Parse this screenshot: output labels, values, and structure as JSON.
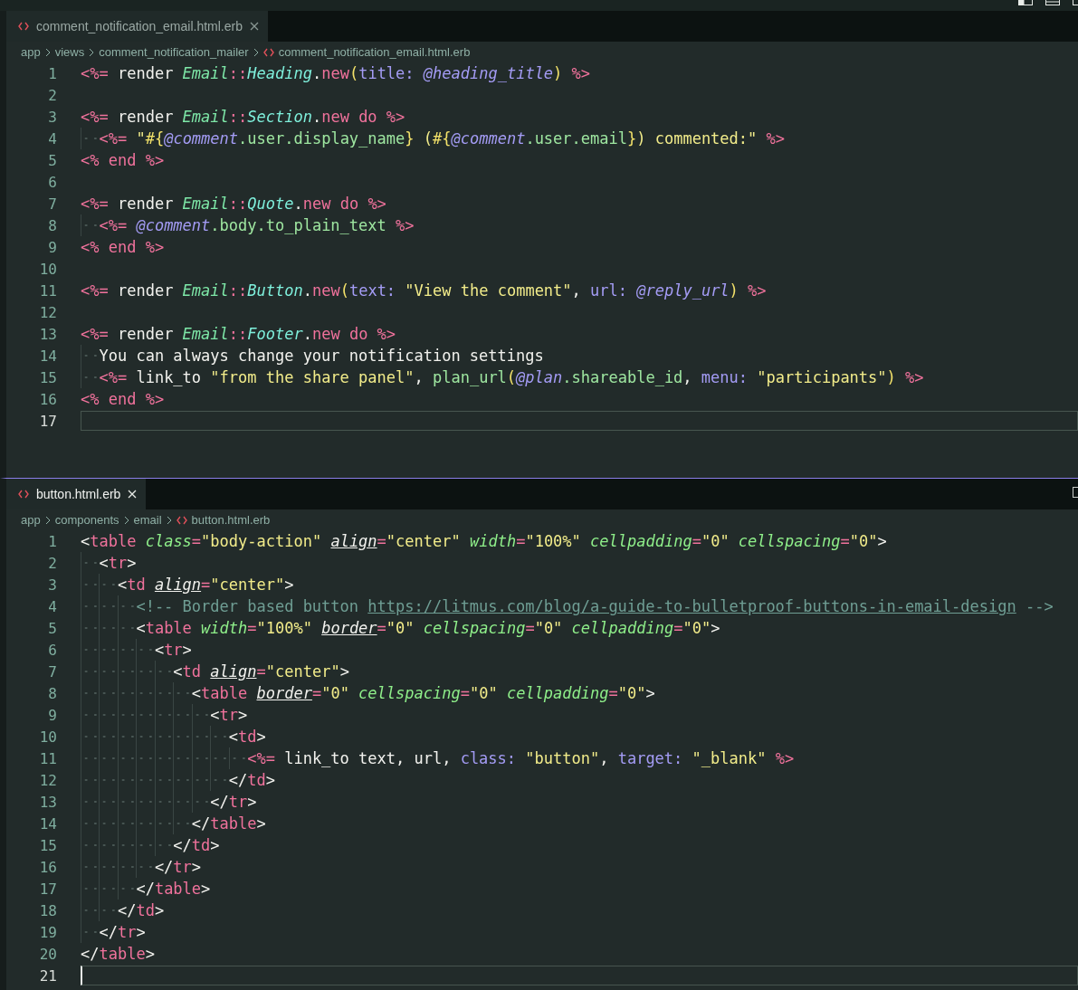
{
  "editors": [
    {
      "tab": {
        "label": "comment_notification_email.html.erb",
        "selected": false
      },
      "breadcrumbs": [
        {
          "label": "app",
          "kind": "folder"
        },
        {
          "label": "views",
          "kind": "folder"
        },
        {
          "label": "comment_notification_mailer",
          "kind": "folder"
        },
        {
          "label": "comment_notification_email.html.erb",
          "kind": "file"
        }
      ],
      "lines": [
        {
          "number": "1",
          "tokens": [
            {
              "text": "<%=",
              "kind": "delim"
            },
            {
              "text": " render ",
              "kind": "text"
            },
            {
              "text": "Email",
              "kind": "constant"
            },
            {
              "text": "::",
              "kind": "keyword"
            },
            {
              "text": "Heading",
              "kind": "class"
            },
            {
              "text": ".",
              "kind": "text"
            },
            {
              "text": "new",
              "kind": "keyword"
            },
            {
              "text": "(",
              "kind": "paren"
            },
            {
              "text": "title:",
              "kind": "symbol"
            },
            {
              "text": " @heading_title",
              "kind": "ivar"
            },
            {
              "text": ")",
              "kind": "paren"
            },
            {
              "text": " %>",
              "kind": "delim"
            }
          ]
        },
        {
          "number": "2"
        },
        {
          "number": "3",
          "tokens": [
            {
              "text": "<%=",
              "kind": "delim"
            },
            {
              "text": " render ",
              "kind": "text"
            },
            {
              "text": "Email",
              "kind": "constant"
            },
            {
              "text": "::",
              "kind": "keyword"
            },
            {
              "text": "Section",
              "kind": "class"
            },
            {
              "text": ".",
              "kind": "text"
            },
            {
              "text": "new do",
              "kind": "keyword"
            },
            {
              "text": " %>",
              "kind": "delim"
            }
          ],
          "children": [
            {
              "number": "4",
              "tokens": [
                {
                  "text": "<%=",
                  "kind": "delim"
                },
                {
                  "text": " \"",
                  "kind": "string"
                },
                {
                  "text": "#{",
                  "kind": "paren"
                },
                {
                  "text": "@comment",
                  "kind": "ivar"
                },
                {
                  "text": ".user.display_name",
                  "kind": "method"
                },
                {
                  "text": "}",
                  "kind": "paren"
                },
                {
                  "text": " (",
                  "kind": "string"
                },
                {
                  "text": "#{",
                  "kind": "paren"
                },
                {
                  "text": "@comment",
                  "kind": "ivar"
                },
                {
                  "text": ".user.email",
                  "kind": "method"
                },
                {
                  "text": "}",
                  "kind": "paren"
                },
                {
                  "text": ") commented:\"",
                  "kind": "string"
                },
                {
                  "text": " %>",
                  "kind": "delim"
                }
              ]
            }
          ]
        },
        {
          "number": "5",
          "tokens": [
            {
              "text": "<%",
              "kind": "delim"
            },
            {
              "text": " end ",
              "kind": "keyword"
            },
            {
              "text": "%>",
              "kind": "delim"
            }
          ]
        },
        {
          "number": "6"
        },
        {
          "number": "7",
          "tokens": [
            {
              "text": "<%=",
              "kind": "delim"
            },
            {
              "text": " render ",
              "kind": "text"
            },
            {
              "text": "Email",
              "kind": "constant"
            },
            {
              "text": "::",
              "kind": "keyword"
            },
            {
              "text": "Quote",
              "kind": "class"
            },
            {
              "text": ".",
              "kind": "text"
            },
            {
              "text": "new do",
              "kind": "keyword"
            },
            {
              "text": " %>",
              "kind": "delim"
            }
          ],
          "children": [
            {
              "number": "8",
              "tokens": [
                {
                  "text": "<%=",
                  "kind": "delim"
                },
                {
                  "text": " @comment",
                  "kind": "ivar"
                },
                {
                  "text": ".body.to_plain_text",
                  "kind": "method"
                },
                {
                  "text": " %>",
                  "kind": "delim"
                }
              ]
            }
          ]
        },
        {
          "number": "9",
          "tokens": [
            {
              "text": "<%",
              "kind": "delim"
            },
            {
              "text": " end ",
              "kind": "keyword"
            },
            {
              "text": "%>",
              "kind": "delim"
            }
          ]
        },
        {
          "number": "10"
        },
        {
          "number": "11",
          "tokens": [
            {
              "text": "<%=",
              "kind": "delim"
            },
            {
              "text": " render ",
              "kind": "text"
            },
            {
              "text": "Email",
              "kind": "constant"
            },
            {
              "text": "::",
              "kind": "keyword"
            },
            {
              "text": "Button",
              "kind": "class"
            },
            {
              "text": ".",
              "kind": "text"
            },
            {
              "text": "new",
              "kind": "keyword"
            },
            {
              "text": "(",
              "kind": "paren"
            },
            {
              "text": "text:",
              "kind": "symbol"
            },
            {
              "text": " \"View the comment\"",
              "kind": "string"
            },
            {
              "text": ", ",
              "kind": "text"
            },
            {
              "text": "url:",
              "kind": "symbol"
            },
            {
              "text": " @reply_url",
              "kind": "ivar"
            },
            {
              "text": ")",
              "kind": "paren"
            },
            {
              "text": " %>",
              "kind": "delim"
            }
          ]
        },
        {
          "number": "12"
        },
        {
          "number": "13",
          "tokens": [
            {
              "text": "<%=",
              "kind": "delim"
            },
            {
              "text": " render ",
              "kind": "text"
            },
            {
              "text": "Email",
              "kind": "constant"
            },
            {
              "text": "::",
              "kind": "keyword"
            },
            {
              "text": "Footer",
              "kind": "class"
            },
            {
              "text": ".",
              "kind": "text"
            },
            {
              "text": "new do",
              "kind": "keyword"
            },
            {
              "text": " %>",
              "kind": "delim"
            }
          ],
          "children": [
            {
              "number": "14",
              "tokens": [
                {
                  "text": "You can always change your notification settings",
                  "kind": "text"
                }
              ]
            },
            {
              "number": "15",
              "tokens": [
                {
                  "text": "<%=",
                  "kind": "delim"
                },
                {
                  "text": " link_to ",
                  "kind": "text"
                },
                {
                  "text": "\"from the share panel\"",
                  "kind": "string"
                },
                {
                  "text": ", ",
                  "kind": "text"
                },
                {
                  "text": "plan_url",
                  "kind": "method"
                },
                {
                  "text": "(",
                  "kind": "paren"
                },
                {
                  "text": "@plan",
                  "kind": "ivar"
                },
                {
                  "text": ".shareable_id",
                  "kind": "method"
                },
                {
                  "text": ", ",
                  "kind": "text"
                },
                {
                  "text": "menu:",
                  "kind": "symbol"
                },
                {
                  "text": " \"participants\"",
                  "kind": "string"
                },
                {
                  "text": ")",
                  "kind": "paren"
                },
                {
                  "text": " %>",
                  "kind": "delim"
                }
              ]
            }
          ]
        },
        {
          "number": "16",
          "tokens": [
            {
              "text": "<%",
              "kind": "delim"
            },
            {
              "text": " end ",
              "kind": "keyword"
            },
            {
              "text": "%>",
              "kind": "delim"
            }
          ]
        },
        {
          "number": "17",
          "current": true
        }
      ]
    },
    {
      "tab": {
        "label": "button.html.erb",
        "selected": true
      },
      "breadcrumbs": [
        {
          "label": "app",
          "kind": "folder"
        },
        {
          "label": "components",
          "kind": "folder"
        },
        {
          "label": "email",
          "kind": "folder"
        },
        {
          "label": "button.html.erb",
          "kind": "file"
        }
      ],
      "lines": [
        {
          "number": "1",
          "tokens": [
            {
              "text": "<",
              "kind": "text"
            },
            {
              "text": "table ",
              "kind": "tag"
            },
            {
              "text": "class",
              "kind": "attr"
            },
            {
              "text": "=",
              "kind": "keyword"
            },
            {
              "text": "\"body-action\" ",
              "kind": "string"
            },
            {
              "text": "align",
              "kind": "attr-deprecated"
            },
            {
              "text": "=",
              "kind": "keyword"
            },
            {
              "text": "\"center\" ",
              "kind": "string"
            },
            {
              "text": "width",
              "kind": "attr"
            },
            {
              "text": "=",
              "kind": "keyword"
            },
            {
              "text": "\"100%\" ",
              "kind": "string"
            },
            {
              "text": "cellpadding",
              "kind": "attr"
            },
            {
              "text": "=",
              "kind": "keyword"
            },
            {
              "text": "\"0\" ",
              "kind": "string"
            },
            {
              "text": "cellspacing",
              "kind": "attr"
            },
            {
              "text": "=",
              "kind": "keyword"
            },
            {
              "text": "\"0\"",
              "kind": "string"
            },
            {
              "text": ">",
              "kind": "text"
            }
          ],
          "children": [
            {
              "number": "2",
              "tokens": [
                {
                  "text": "<",
                  "kind": "text"
                },
                {
                  "text": "tr",
                  "kind": "tag"
                },
                {
                  "text": ">",
                  "kind": "text"
                }
              ],
              "children": [
                {
                  "number": "3",
                  "tokens": [
                    {
                      "text": "<",
                      "kind": "text"
                    },
                    {
                      "text": "td ",
                      "kind": "tag"
                    },
                    {
                      "text": "align",
                      "kind": "attr-deprecated"
                    },
                    {
                      "text": "=",
                      "kind": "keyword"
                    },
                    {
                      "text": "\"center\"",
                      "kind": "string"
                    },
                    {
                      "text": ">",
                      "kind": "text"
                    }
                  ],
                  "children": [
                    {
                      "number": "4",
                      "tokens": [
                        {
                          "text": "<!-- Border based button ",
                          "kind": "comment"
                        },
                        {
                          "text": "https://litmus.com/blog/a-guide-to-bulletproof-buttons-in-email-design",
                          "kind": "url"
                        },
                        {
                          "text": " -->",
                          "kind": "comment"
                        }
                      ]
                    },
                    {
                      "number": "5",
                      "tokens": [
                        {
                          "text": "<",
                          "kind": "text"
                        },
                        {
                          "text": "table ",
                          "kind": "tag"
                        },
                        {
                          "text": "width",
                          "kind": "attr"
                        },
                        {
                          "text": "=",
                          "kind": "keyword"
                        },
                        {
                          "text": "\"100%\" ",
                          "kind": "string"
                        },
                        {
                          "text": "border",
                          "kind": "attr-deprecated"
                        },
                        {
                          "text": "=",
                          "kind": "keyword"
                        },
                        {
                          "text": "\"0\" ",
                          "kind": "string"
                        },
                        {
                          "text": "cellspacing",
                          "kind": "attr"
                        },
                        {
                          "text": "=",
                          "kind": "keyword"
                        },
                        {
                          "text": "\"0\" ",
                          "kind": "string"
                        },
                        {
                          "text": "cellpadding",
                          "kind": "attr"
                        },
                        {
                          "text": "=",
                          "kind": "keyword"
                        },
                        {
                          "text": "\"0\"",
                          "kind": "string"
                        },
                        {
                          "text": ">",
                          "kind": "text"
                        }
                      ],
                      "children": [
                        {
                          "number": "6",
                          "tokens": [
                            {
                              "text": "<",
                              "kind": "text"
                            },
                            {
                              "text": "tr",
                              "kind": "tag"
                            },
                            {
                              "text": ">",
                              "kind": "text"
                            }
                          ],
                          "children": [
                            {
                              "number": "7",
                              "tokens": [
                                {
                                  "text": "<",
                                  "kind": "text"
                                },
                                {
                                  "text": "td ",
                                  "kind": "tag"
                                },
                                {
                                  "text": "align",
                                  "kind": "attr-deprecated"
                                },
                                {
                                  "text": "=",
                                  "kind": "keyword"
                                },
                                {
                                  "text": "\"center\"",
                                  "kind": "string"
                                },
                                {
                                  "text": ">",
                                  "kind": "text"
                                }
                              ],
                              "children": [
                                {
                                  "number": "8",
                                  "tokens": [
                                    {
                                      "text": "<",
                                      "kind": "text"
                                    },
                                    {
                                      "text": "table ",
                                      "kind": "tag"
                                    },
                                    {
                                      "text": "border",
                                      "kind": "attr-deprecated"
                                    },
                                    {
                                      "text": "=",
                                      "kind": "keyword"
                                    },
                                    {
                                      "text": "\"0\" ",
                                      "kind": "string"
                                    },
                                    {
                                      "text": "cellspacing",
                                      "kind": "attr"
                                    },
                                    {
                                      "text": "=",
                                      "kind": "keyword"
                                    },
                                    {
                                      "text": "\"0\" ",
                                      "kind": "string"
                                    },
                                    {
                                      "text": "cellpadding",
                                      "kind": "attr"
                                    },
                                    {
                                      "text": "=",
                                      "kind": "keyword"
                                    },
                                    {
                                      "text": "\"0\"",
                                      "kind": "string"
                                    },
                                    {
                                      "text": ">",
                                      "kind": "text"
                                    }
                                  ],
                                  "children": [
                                    {
                                      "number": "9",
                                      "tokens": [
                                        {
                                          "text": "<",
                                          "kind": "text"
                                        },
                                        {
                                          "text": "tr",
                                          "kind": "tag"
                                        },
                                        {
                                          "text": ">",
                                          "kind": "text"
                                        }
                                      ],
                                      "children": [
                                        {
                                          "number": "10",
                                          "tokens": [
                                            {
                                              "text": "<",
                                              "kind": "text"
                                            },
                                            {
                                              "text": "td",
                                              "kind": "tag"
                                            },
                                            {
                                              "text": ">",
                                              "kind": "text"
                                            }
                                          ],
                                          "children": [
                                            {
                                              "number": "11",
                                              "tokens": [
                                                {
                                                  "text": "<%=",
                                                  "kind": "delim"
                                                },
                                                {
                                                  "text": " link_to text, url, ",
                                                  "kind": "text"
                                                },
                                                {
                                                  "text": "class:",
                                                  "kind": "symbol"
                                                },
                                                {
                                                  "text": " \"button\"",
                                                  "kind": "string"
                                                },
                                                {
                                                  "text": ", ",
                                                  "kind": "text"
                                                },
                                                {
                                                  "text": "target:",
                                                  "kind": "symbol"
                                                },
                                                {
                                                  "text": " \"_blank\"",
                                                  "kind": "string"
                                                },
                                                {
                                                  "text": " %>",
                                                  "kind": "delim"
                                                }
                                              ]
                                            }
                                          ]
                                        },
                                        {
                                          "number": "12",
                                          "tokens": [
                                            {
                                              "text": "</",
                                              "kind": "text"
                                            },
                                            {
                                              "text": "td",
                                              "kind": "tag"
                                            },
                                            {
                                              "text": ">",
                                              "kind": "text"
                                            }
                                          ]
                                        }
                                      ]
                                    },
                                    {
                                      "number": "13",
                                      "tokens": [
                                        {
                                          "text": "</",
                                          "kind": "text"
                                        },
                                        {
                                          "text": "tr",
                                          "kind": "tag"
                                        },
                                        {
                                          "text": ">",
                                          "kind": "text"
                                        }
                                      ]
                                    }
                                  ]
                                },
                                {
                                  "number": "14",
                                  "tokens": [
                                    {
                                      "text": "</",
                                      "kind": "text"
                                    },
                                    {
                                      "text": "table",
                                      "kind": "tag"
                                    },
                                    {
                                      "text": ">",
                                      "kind": "text"
                                    }
                                  ]
                                }
                              ]
                            },
                            {
                              "number": "15",
                              "tokens": [
                                {
                                  "text": "</",
                                  "kind": "text"
                                },
                                {
                                  "text": "td",
                                  "kind": "tag"
                                },
                                {
                                  "text": ">",
                                  "kind": "text"
                                }
                              ]
                            }
                          ]
                        },
                        {
                          "number": "16",
                          "tokens": [
                            {
                              "text": "</",
                              "kind": "text"
                            },
                            {
                              "text": "tr",
                              "kind": "tag"
                            },
                            {
                              "text": ">",
                              "kind": "text"
                            }
                          ]
                        }
                      ]
                    },
                    {
                      "number": "17",
                      "tokens": [
                        {
                          "text": "</",
                          "kind": "text"
                        },
                        {
                          "text": "table",
                          "kind": "tag"
                        },
                        {
                          "text": ">",
                          "kind": "text"
                        }
                      ]
                    }
                  ]
                },
                {
                  "number": "18",
                  "tokens": [
                    {
                      "text": "</",
                      "kind": "text"
                    },
                    {
                      "text": "td",
                      "kind": "tag"
                    },
                    {
                      "text": ">",
                      "kind": "text"
                    }
                  ]
                }
              ]
            },
            {
              "number": "19",
              "tokens": [
                {
                  "text": "</",
                  "kind": "text"
                },
                {
                  "text": "tr",
                  "kind": "tag"
                },
                {
                  "text": ">",
                  "kind": "text"
                }
              ]
            }
          ]
        },
        {
          "number": "20",
          "tokens": [
            {
              "text": "</",
              "kind": "text"
            },
            {
              "text": "table",
              "kind": "tag"
            },
            {
              "text": ">",
              "kind": "text"
            }
          ]
        },
        {
          "number": "21",
          "current": true
        }
      ]
    }
  ]
}
